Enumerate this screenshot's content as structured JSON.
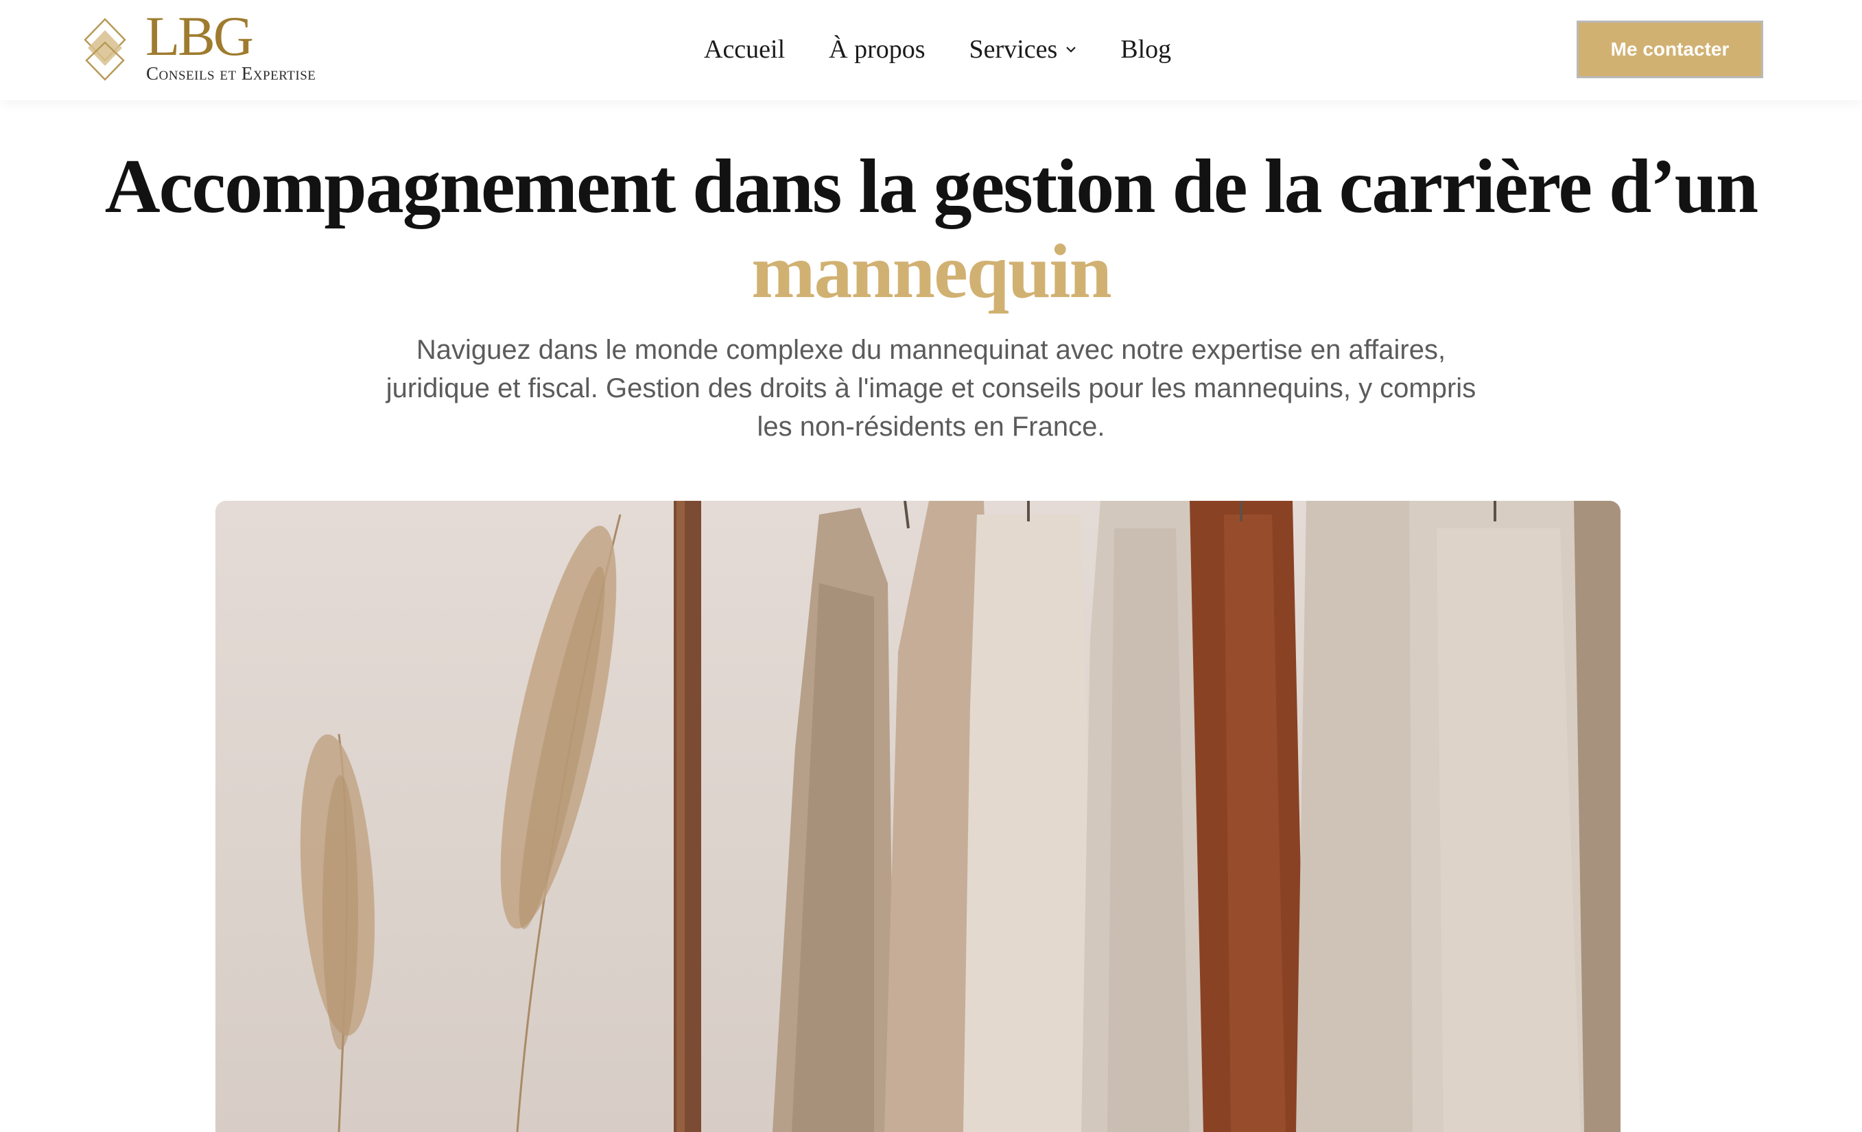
{
  "brand": {
    "logo_text": "LBG",
    "tagline": "Conseils et Expertise",
    "color_gold": "#d1b172",
    "color_logo": "#9e7b2e"
  },
  "nav": {
    "items": [
      {
        "label": "Accueil"
      },
      {
        "label": "À propos"
      },
      {
        "label": "Services",
        "has_dropdown": true,
        "icon": "chevron-down-icon"
      },
      {
        "label": "Blog"
      }
    ],
    "cta_label": "Me contacter"
  },
  "hero": {
    "title_main": "Accompagnement dans la gestion de la carrière d’un",
    "title_accent": "mannequin",
    "subtitle": "Naviguez dans le monde complexe du mannequinat avec notre expertise en affaires, juridique et fiscal. Gestion des droits à l'image et conseils pour les mannequins, y compris les non-résidents en France."
  }
}
